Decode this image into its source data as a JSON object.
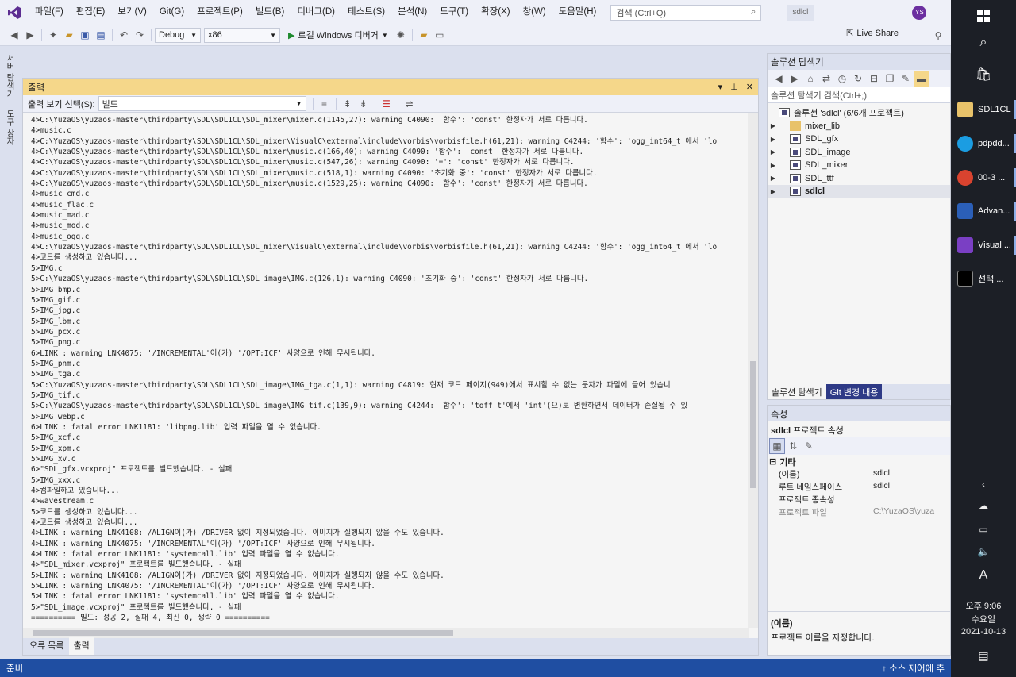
{
  "menubar": {
    "items": [
      "파일(F)",
      "편집(E)",
      "보기(V)",
      "Git(G)",
      "프로젝트(P)",
      "빌드(B)",
      "디버그(D)",
      "테스트(S)",
      "분석(N)",
      "도구(T)",
      "확장(X)",
      "창(W)",
      "도움말(H)"
    ],
    "search_placeholder": "검색 (Ctrl+Q)",
    "solution_name": "sdlcl",
    "avatar_initials": "YS"
  },
  "toolbar": {
    "config": "Debug",
    "platform": "x86",
    "start_label": "로컬 Windows 디버거",
    "live_share": "Live Share"
  },
  "left_tabs": [
    "서버 탐색기",
    "도구 상자"
  ],
  "output": {
    "title": "출력",
    "show_from_label": "출력 보기 선택(S):",
    "show_from_value": "빌드",
    "lines": [
      "4>C:\\YuzaOS\\yuzaos-master\\thirdparty\\SDL\\SDL1CL\\SDL_mixer\\mixer.c(1145,27): warning C4090: '함수': 'const' 한정자가 서로 다릅니다.",
      "4>music.c",
      "4>C:\\YuzaOS\\yuzaos-master\\thirdparty\\SDL\\SDL1CL\\SDL_mixer\\VisualC\\external\\include\\vorbis\\vorbisfile.h(61,21): warning C4244: '함수': 'ogg_int64_t'에서 'lo",
      "4>C:\\YuzaOS\\yuzaos-master\\thirdparty\\SDL\\SDL1CL\\SDL_mixer\\music.c(166,40): warning C4090: '함수': 'const' 한정자가 서로 다릅니다.",
      "4>C:\\YuzaOS\\yuzaos-master\\thirdparty\\SDL\\SDL1CL\\SDL_mixer\\music.c(547,26): warning C4090: '=': 'const' 한정자가 서로 다릅니다.",
      "4>C:\\YuzaOS\\yuzaos-master\\thirdparty\\SDL\\SDL1CL\\SDL_mixer\\music.c(518,1): warning C4090: '초기화 중': 'const' 한정자가 서로 다릅니다.",
      "4>C:\\YuzaOS\\yuzaos-master\\thirdparty\\SDL\\SDL1CL\\SDL_mixer\\music.c(1529,25): warning C4090: '함수': 'const' 한정자가 서로 다릅니다.",
      "4>music_cmd.c",
      "4>music_flac.c",
      "4>music_mad.c",
      "4>music_mod.c",
      "4>music_ogg.c",
      "4>C:\\YuzaOS\\yuzaos-master\\thirdparty\\SDL\\SDL1CL\\SDL_mixer\\VisualC\\external\\include\\vorbis\\vorbisfile.h(61,21): warning C4244: '함수': 'ogg_int64_t'에서 'lo",
      "4>코드를 생성하고 있습니다...",
      "5>IMG.c",
      "5>C:\\YuzaOS\\yuzaos-master\\thirdparty\\SDL\\SDL1CL\\SDL_image\\IMG.c(126,1): warning C4090: '초기화 중': 'const' 한정자가 서로 다릅니다.",
      "5>IMG_bmp.c",
      "5>IMG_gif.c",
      "5>IMG_jpg.c",
      "5>IMG_lbm.c",
      "5>IMG_pcx.c",
      "5>IMG_png.c",
      "6>LINK : warning LNK4075: '/INCREMENTAL'이(가) '/OPT:ICF' 사양으로 인해 무시됩니다.",
      "5>IMG_pnm.c",
      "5>IMG_tga.c",
      "5>C:\\YuzaOS\\yuzaos-master\\thirdparty\\SDL\\SDL1CL\\SDL_image\\IMG_tga.c(1,1): warning C4819: 현재 코드 페이지(949)에서 표시할 수 없는 문자가 파일에 들어 있습니",
      "5>IMG_tif.c",
      "5>C:\\YuzaOS\\yuzaos-master\\thirdparty\\SDL\\SDL1CL\\SDL_image\\IMG_tif.c(139,9): warning C4244: '함수': 'toff_t'에서 'int'(으)로 변환하면서 데이터가 손실될 수 있",
      "5>IMG_webp.c",
      "6>LINK : fatal error LNK1181: 'libpng.lib' 입력 파일을 열 수 없습니다.",
      "5>IMG_xcf.c",
      "5>IMG_xpm.c",
      "5>IMG_xv.c",
      "6>\"SDL_gfx.vcxproj\" 프로젝트를 빌드했습니다. - 실패",
      "5>IMG_xxx.c",
      "4>컴파일하고 있습니다...",
      "4>wavestream.c",
      "5>코드를 생성하고 있습니다...",
      "4>코드를 생성하고 있습니다...",
      "4>LINK : warning LNK4108: /ALIGN이(가) /DRIVER 없이 지정되었습니다. 이미지가 실행되지 않을 수도 있습니다.",
      "4>LINK : warning LNK4075: '/INCREMENTAL'이(가) '/OPT:ICF' 사양으로 인해 무시됩니다.",
      "4>LINK : fatal error LNK1181: 'systemcall.lib' 입력 파일을 열 수 없습니다.",
      "4>\"SDL_mixer.vcxproj\" 프로젝트를 빌드했습니다. - 실패",
      "5>LINK : warning LNK4108: /ALIGN이(가) /DRIVER 없이 지정되었습니다. 이미지가 실행되지 않을 수도 있습니다.",
      "5>LINK : warning LNK4075: '/INCREMENTAL'이(가) '/OPT:ICF' 사양으로 인해 무시됩니다.",
      "5>LINK : fatal error LNK1181: 'systemcall.lib' 입력 파일을 열 수 없습니다.",
      "5>\"SDL_image.vcxproj\" 프로젝트를 빌드했습니다. - 실패",
      "========== 빌드: 성공 2, 실패 4, 최신 0, 생략 0 =========="
    ],
    "tabs": [
      "오류 목록",
      "출력"
    ]
  },
  "solution_explorer": {
    "title": "솔루션 탐색기",
    "search_placeholder": "솔루션 탐색기 검색(Ctrl+;)",
    "root": "솔루션 'sdlcl' (6/6개 프로젝트)",
    "items": [
      "mixer_lib",
      "SDL_gfx",
      "SDL_image",
      "SDL_mixer",
      "SDL_ttf",
      "sdlcl"
    ],
    "tabs": [
      "솔루션 탐색기",
      "Git 변경 내용"
    ]
  },
  "properties": {
    "title": "속성",
    "object_name": "sdlcl",
    "object_type": "프로젝트 속성",
    "category": "기타",
    "rows": [
      {
        "k": "(이름)",
        "v": "sdlcl"
      },
      {
        "k": "루트 네임스페이스",
        "v": "sdlcl"
      },
      {
        "k": "프로젝트 종속성",
        "v": ""
      },
      {
        "k": "프로젝트 파일",
        "v": "C:\\YuzaOS\\yuza"
      }
    ],
    "desc_title": "(이름)",
    "desc_text": "프로젝트 이름을 지정합니다."
  },
  "status": {
    "ready": "준비",
    "source_control": "↑ 소스 제어에 추"
  },
  "taskbar": {
    "apps": [
      "SDL1CL",
      "pdpdd...",
      "00-3 ...",
      "Advan...",
      "Visual ...",
      "선택 ..."
    ],
    "ime": "A",
    "time": "오후 9:06",
    "day": "수요일",
    "date": "2021-10-13"
  }
}
